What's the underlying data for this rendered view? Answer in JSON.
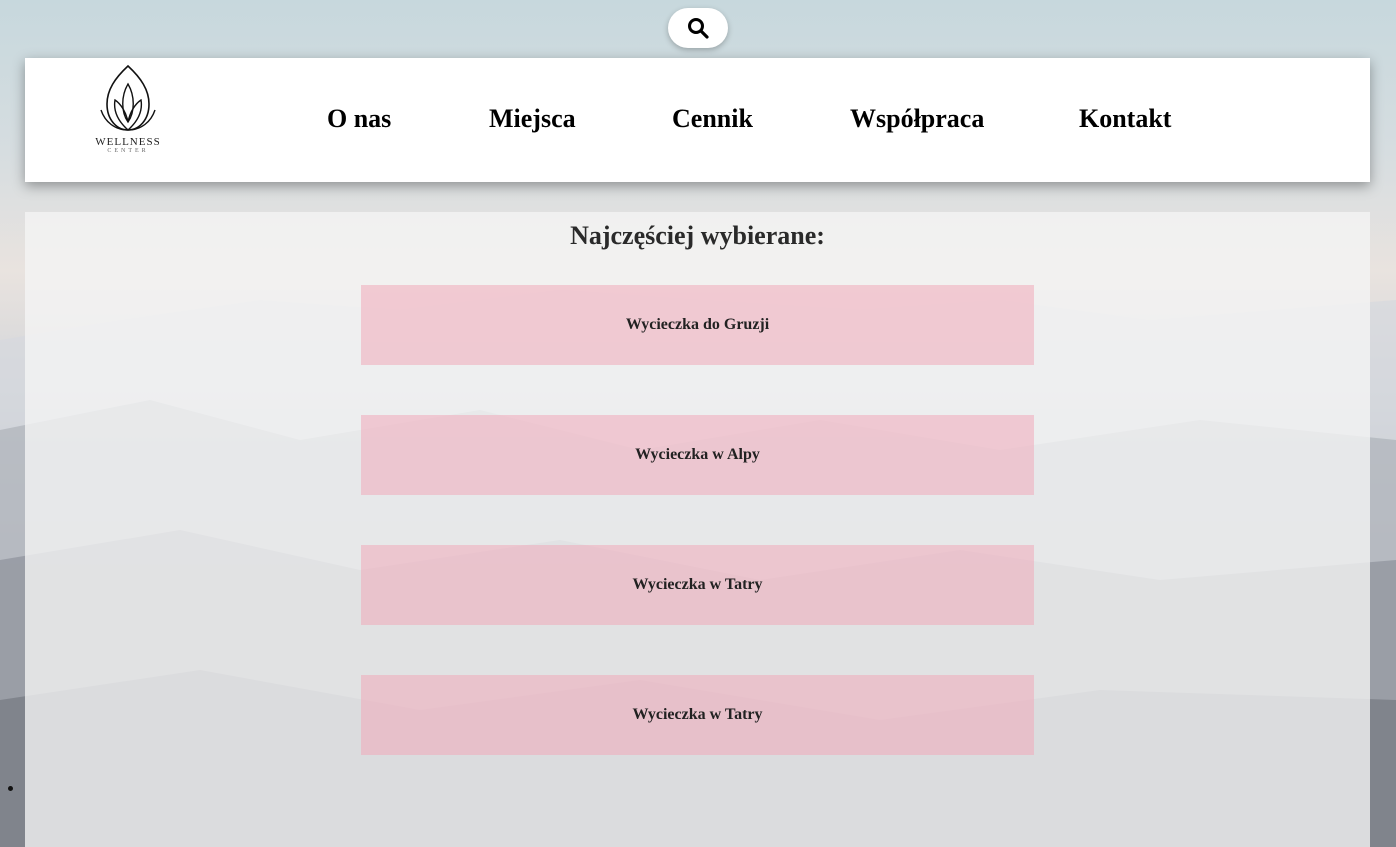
{
  "search": {
    "icon": "search-icon"
  },
  "logo": {
    "name": "WELLNESS",
    "sub": "CENTER",
    "icon": "lotus-icon"
  },
  "nav": {
    "items": [
      {
        "label": "O nas"
      },
      {
        "label": "Miejsca"
      },
      {
        "label": "Cennik"
      },
      {
        "label": "Współpraca"
      },
      {
        "label": "Kontakt"
      }
    ]
  },
  "main": {
    "title": "Najczęściej wybierane:",
    "trips": [
      {
        "label": "Wycieczka do Gruzji"
      },
      {
        "label": "Wycieczka w Alpy"
      },
      {
        "label": "Wycieczka w Tatry"
      },
      {
        "label": "Wycieczka w Tatry"
      }
    ]
  },
  "colors": {
    "header_bg": "#ffffff",
    "trip_bg": "#f0aab9",
    "text": "#000000"
  }
}
